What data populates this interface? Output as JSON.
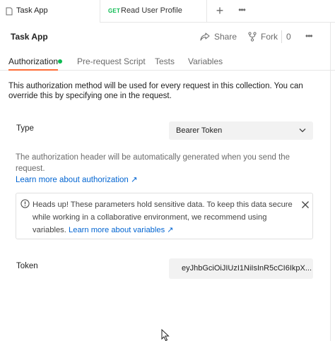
{
  "tabs": [
    {
      "title": "Task App",
      "active": true
    },
    {
      "method": "GET",
      "title": "Read User Profile",
      "active": false
    }
  ],
  "tab_actions": {
    "new_tab": "+",
    "more": "•••"
  },
  "header": {
    "title": "Task App",
    "share_label": "Share",
    "fork_label": "Fork",
    "fork_count": "0",
    "more": "•••"
  },
  "subtabs": [
    {
      "label": "Authorization",
      "active": true
    },
    {
      "label": "Pre-request Script"
    },
    {
      "label": "Tests"
    },
    {
      "label": "Variables"
    }
  ],
  "description": "This authorization method will be used for every request in this collection. You can override this by specifying one in the request.",
  "type_row": {
    "label": "Type",
    "selected": "Bearer Token"
  },
  "auth_help": {
    "text": "The authorization header will be automatically generated when you send the request.",
    "link": "Learn more about authorization ↗"
  },
  "warning": {
    "text": "Heads up! These parameters hold sensitive data. To keep this data secure while working in a collaborative environment, we recommend using variables.",
    "link": "Learn more about variables ↗"
  },
  "token_row": {
    "label": "Token",
    "value": "eyJhbGciOiJIUzI1NiIsInR5cCI6IkpX..."
  },
  "colors": {
    "accent": "#ff6c37",
    "success": "#0cbb52",
    "link": "#0265d2"
  },
  "icons": [
    "collection-icon",
    "share-icon",
    "fork-icon",
    "chevron-down-icon",
    "info-circle-icon",
    "close-icon",
    "mouse-cursor-icon"
  ]
}
